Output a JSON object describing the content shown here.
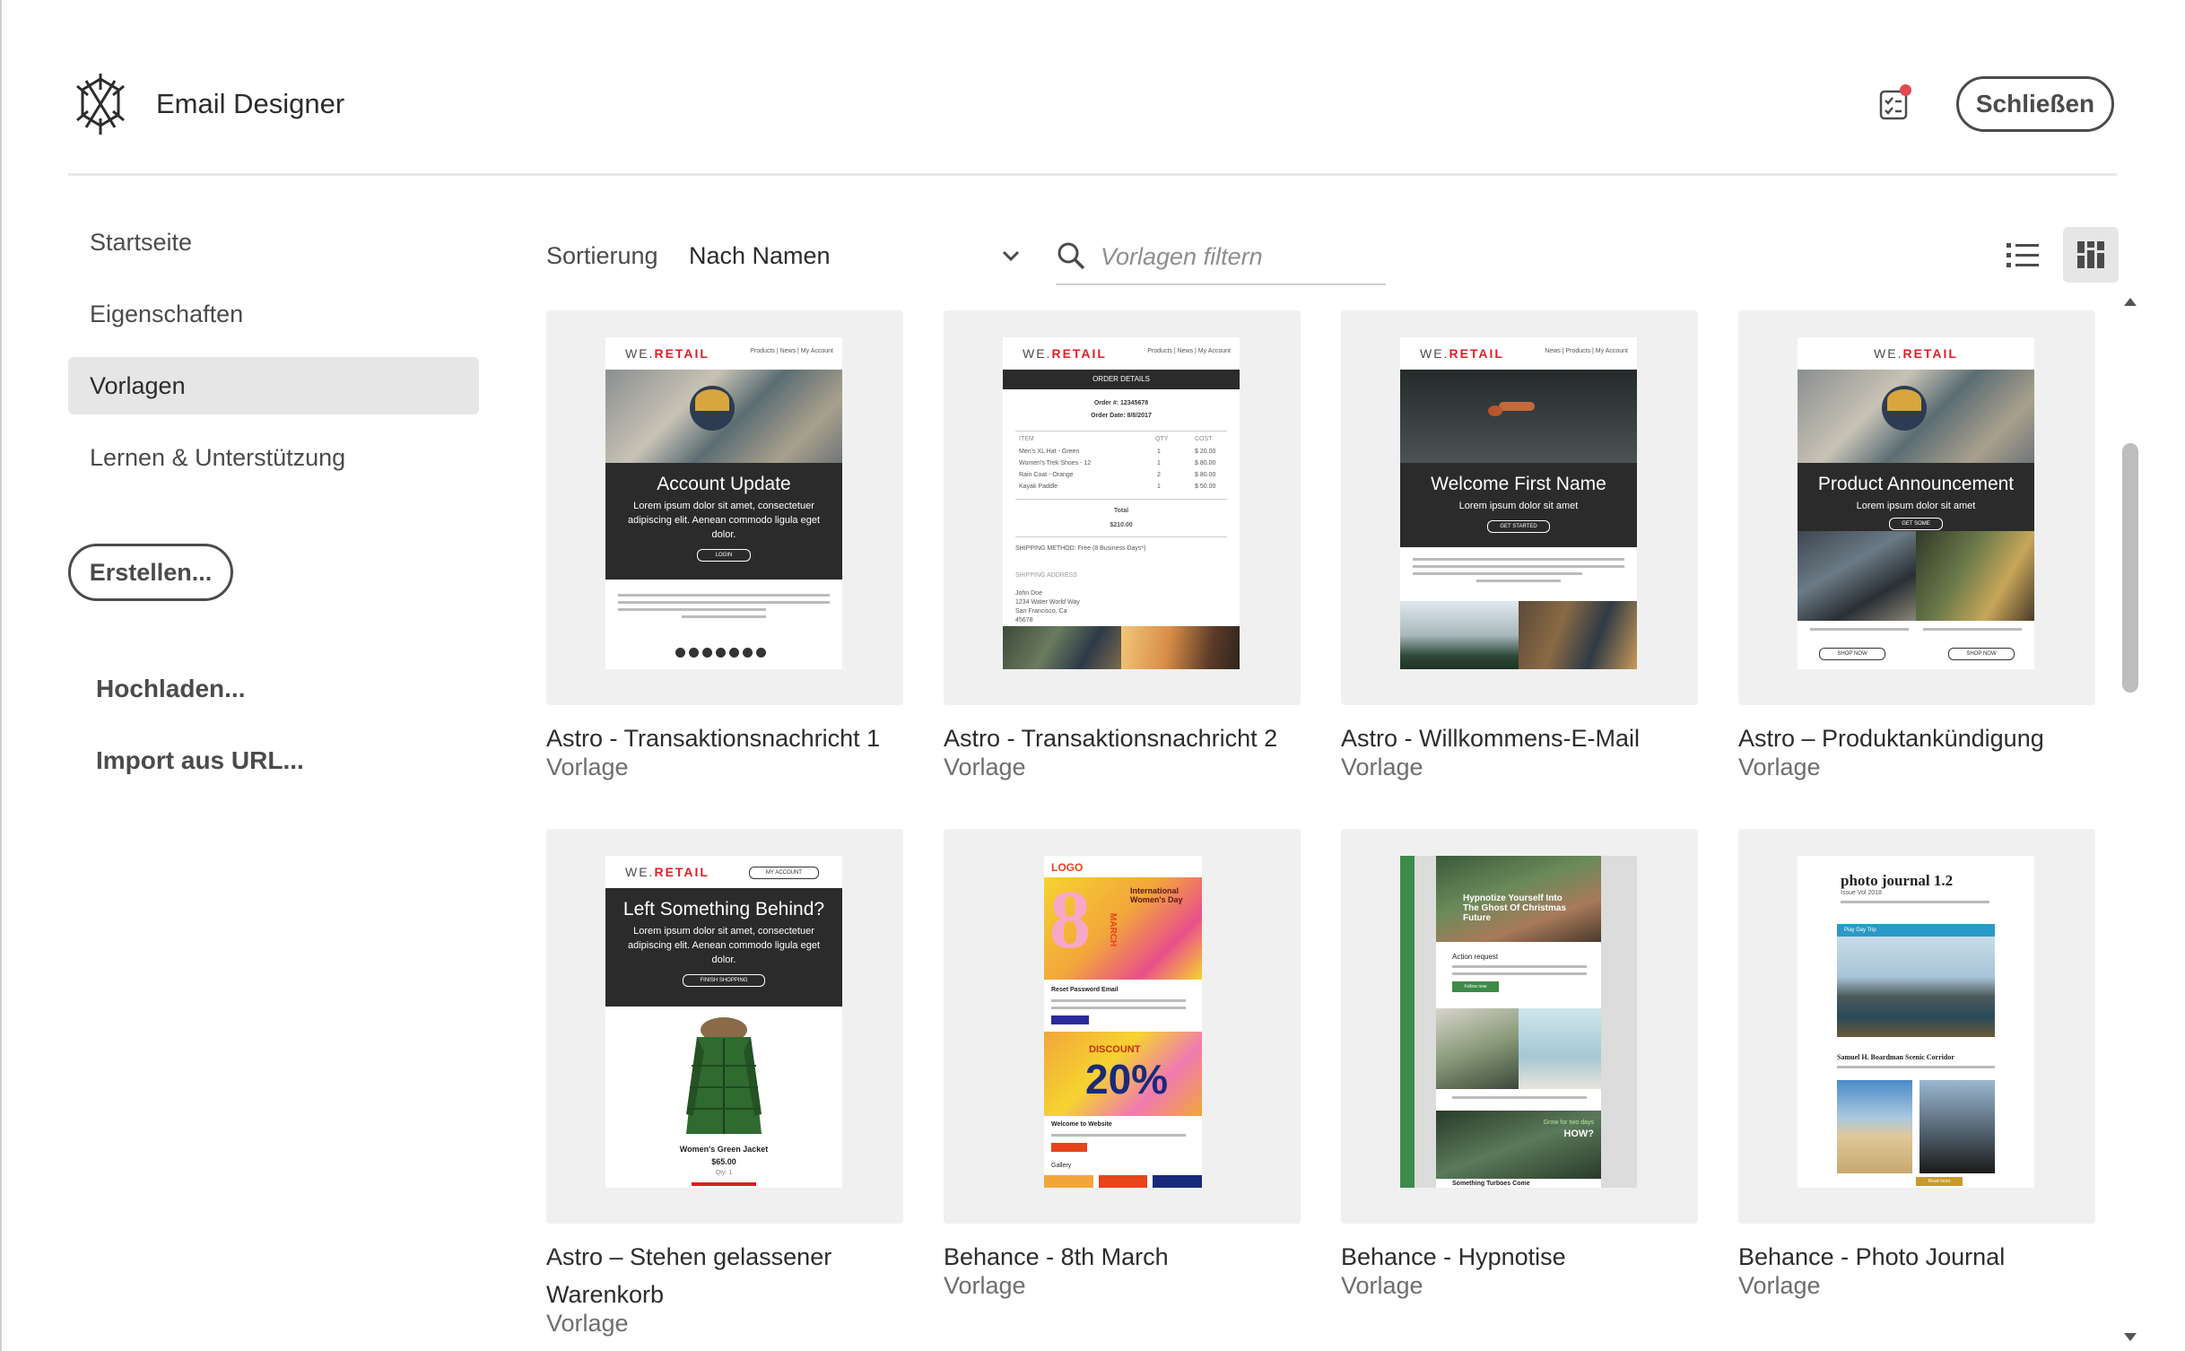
{
  "app": {
    "title": "Email Designer",
    "close_label": "Schließen"
  },
  "sidebar": {
    "items": [
      {
        "label": "Startseite"
      },
      {
        "label": "Eigenschaften"
      },
      {
        "label": "Vorlagen",
        "active": true
      },
      {
        "label": "Lernen & Unterstützung"
      }
    ],
    "create_label": "Erstellen...",
    "upload_label": "Hochladen...",
    "import_label": "Import aus URL..."
  },
  "toolbar": {
    "sort_label": "Sortierung",
    "sort_value": "Nach Namen",
    "filter_placeholder": "Vorlagen filtern",
    "view_mode": "grid"
  },
  "templates": [
    {
      "name": "Astro - Transaktionsnachricht 1",
      "type": "Vorlage",
      "preview": {
        "brand": "WE.",
        "brand_accent": "RETAIL",
        "headline": "Account Update",
        "body": "Lorem ipsum dolor sit amet, consectetuer adipiscing elit. Aenean commodo ligula eget dolor.",
        "cta": "LOGIN",
        "nav": "Products | News | My Account"
      }
    },
    {
      "name": "Astro - Transaktionsnachricht 2",
      "type": "Vorlage",
      "preview": {
        "brand": "WE.",
        "brand_accent": "RETAIL",
        "header": "ORDER DETAILS",
        "order_no": "Order #: 12345678",
        "order_date": "Order Date: 8/8/2017",
        "nav": "Products | News | My Account",
        "columns": [
          "ITEM",
          "QTY",
          "COST"
        ],
        "rows": [
          [
            "Men's XL Hat - Green",
            "1",
            "$ 20.00"
          ],
          [
            "Women's Trek Shoes - 12",
            "1",
            "$ 80.00"
          ],
          [
            "Rain Coat - Orange",
            "2",
            "$ 80.00"
          ],
          [
            "Kayak Paddle",
            "1",
            "$ 50.00"
          ]
        ],
        "total_label": "Total",
        "total": "$210.00",
        "shipping": "SHIPPING METHOD: Free (8 Business Days*)",
        "address_label": "SHIPPING ADDRESS",
        "address": [
          "John Doe",
          "1234 Water World Way",
          "San Francisco, Ca",
          "45678"
        ]
      }
    },
    {
      "name": "Astro - Willkommens-E-Mail",
      "type": "Vorlage",
      "preview": {
        "brand": "WE.",
        "brand_accent": "RETAIL",
        "headline": "Welcome First Name",
        "body": "Lorem ipsum dolor sit amet",
        "cta": "GET STARTED",
        "nav": "News | Products | My Account"
      }
    },
    {
      "name": "Astro – Produktankündigung",
      "type": "Vorlage",
      "preview": {
        "brand": "WE.",
        "brand_accent": "RETAIL",
        "headline": "Product Announcement",
        "body": "Lorem ipsum dolor sit amet",
        "cta": "GET SOME",
        "cta2": "SHOP NOW"
      }
    },
    {
      "name": "Astro – Stehen gelassener Warenkorb",
      "type": "Vorlage",
      "preview": {
        "brand": "WE.",
        "brand_accent": "RETAIL",
        "account": "MY ACCOUNT",
        "headline": "Left Something Behind?",
        "body": "Lorem ipsum dolor sit amet, consectetuer adipiscing elit. Aenean commodo ligula eget dolor.",
        "cta": "FINISH SHOPPING",
        "product": "Women's Green Jacket",
        "price": "$65.00",
        "qty": "Qty: 1"
      }
    },
    {
      "name": "Behance - 8th March",
      "type": "Vorlage",
      "preview": {
        "logo": "LOGO",
        "number": "8",
        "month": "MARCH",
        "caption": "International Women's Day",
        "reset": "Reset Password Email",
        "discount_label": "DISCOUNT",
        "discount": "20%",
        "welcome": "Welcome to Website",
        "gallery": "Gallery"
      }
    },
    {
      "name": "Behance - Hypnotise",
      "type": "Vorlage",
      "preview": {
        "headline": "Hypnotize Yourself Into The Ghost Of Christmas Future",
        "section": "Action request",
        "cta": "Follow now",
        "grow": "Grow for two days",
        "how": "HOW?",
        "footer": "Something Turboes Come"
      }
    },
    {
      "name": "Behance - Photo Journal",
      "type": "Vorlage",
      "preview": {
        "title": "photo journal 1.2",
        "subtitle": "Issue Vol 2018",
        "bar": "Play Day Trip",
        "caption": "Samuel H. Boardman Scenic Corridor",
        "cta": "Read more"
      }
    }
  ]
}
